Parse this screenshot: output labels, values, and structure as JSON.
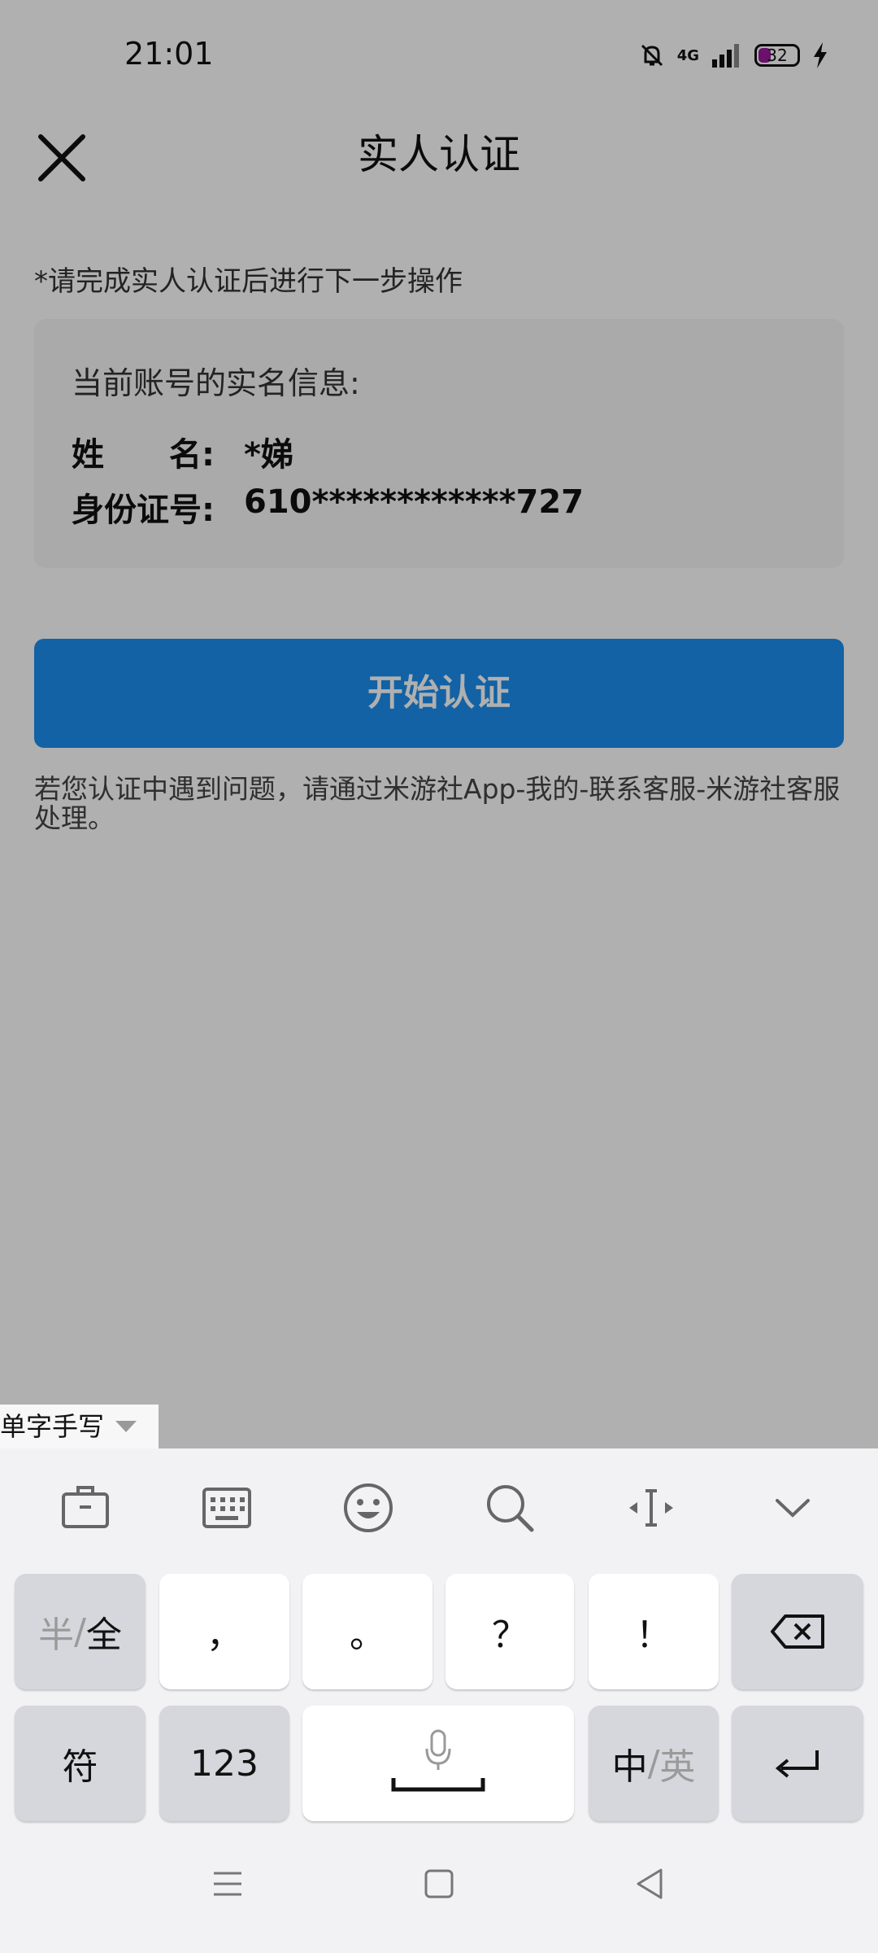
{
  "status_bar": {
    "time": "21:01",
    "network": "4G",
    "battery": "32"
  },
  "header": {
    "title": "实人认证"
  },
  "hint": "*请完成实人认证后进行下一步操作",
  "info_card": {
    "heading": "当前账号的实名信息:",
    "rows": [
      {
        "label": "姓　　名:",
        "value": "*娣"
      },
      {
        "label": "身份证号:",
        "value": "610************727"
      }
    ]
  },
  "start_button": "开始认证",
  "help_text": "若您认证中遇到问题，请通过米游社App-我的-联系客服-米游社客服 处理。",
  "keyboard": {
    "handwriting_mode": "单字手写",
    "toolbar_icons": [
      "clipboard-icon",
      "keyboard-layout-icon",
      "emoji-icon",
      "search-icon",
      "cursor-move-icon",
      "collapse-keyboard-icon"
    ],
    "row1": {
      "half": "半",
      "sep": "/",
      "full": "全",
      "k1": "，",
      "k2": "。",
      "k3": "？",
      "k4": "！"
    },
    "row2": {
      "symbols": "符",
      "numbers": "123",
      "zh": "中",
      "sep": "/",
      "en": "英"
    }
  },
  "colors": {
    "accent": "#1b8ff0",
    "dim_overlay": "rgba(0,0,0,0.31)",
    "battery": "#9b1a9f"
  }
}
